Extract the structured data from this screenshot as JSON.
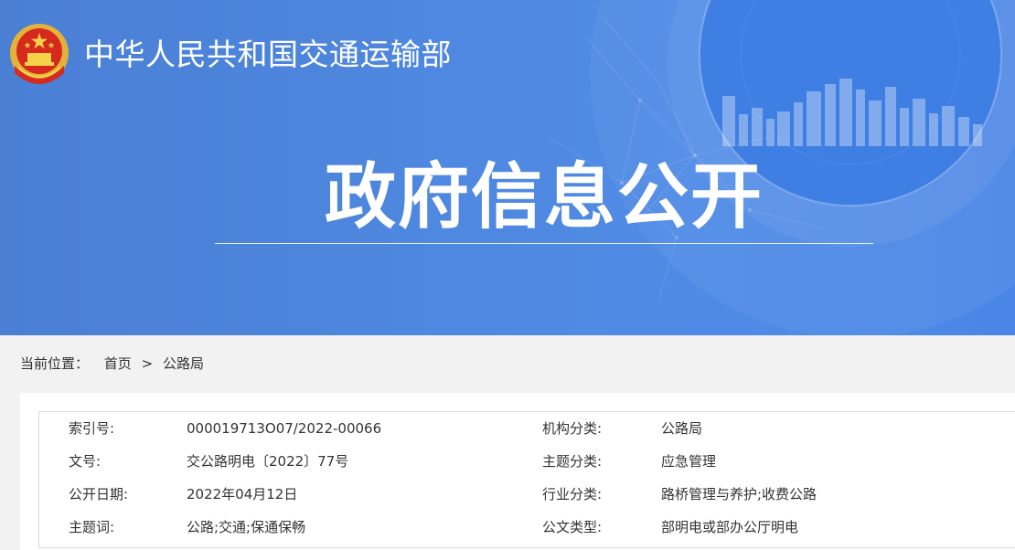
{
  "header": {
    "ministry_name": "中华人民共和国交通运输部",
    "emblem_icon": "national-emblem-icon",
    "headline": "政府信息公开"
  },
  "breadcrumb": {
    "label": "当前位置：",
    "items": [
      "首页",
      "公路局"
    ],
    "separator": ">"
  },
  "meta": {
    "rows": [
      {
        "label1": "索引号:",
        "value1": "000019713O07/2022-00066",
        "label2": "机构分类:",
        "value2": "公路局"
      },
      {
        "label1": "文号:",
        "value1": "交公路明电〔2022〕77号",
        "label2": "主题分类:",
        "value2": "应急管理"
      },
      {
        "label1": "公开日期:",
        "value1": "2022年04月12日",
        "label2": "行业分类:",
        "value2": "路桥管理与养护;收费公路"
      },
      {
        "label1": "主题词:",
        "value1": "公路;交通;保通保畅",
        "label2": "公文类型:",
        "value2": "部明电或部办公厅明电"
      }
    ]
  },
  "colors": {
    "banner_blue": "#4f88e0",
    "page_bg": "#f2f2f2",
    "text": "#333333"
  }
}
